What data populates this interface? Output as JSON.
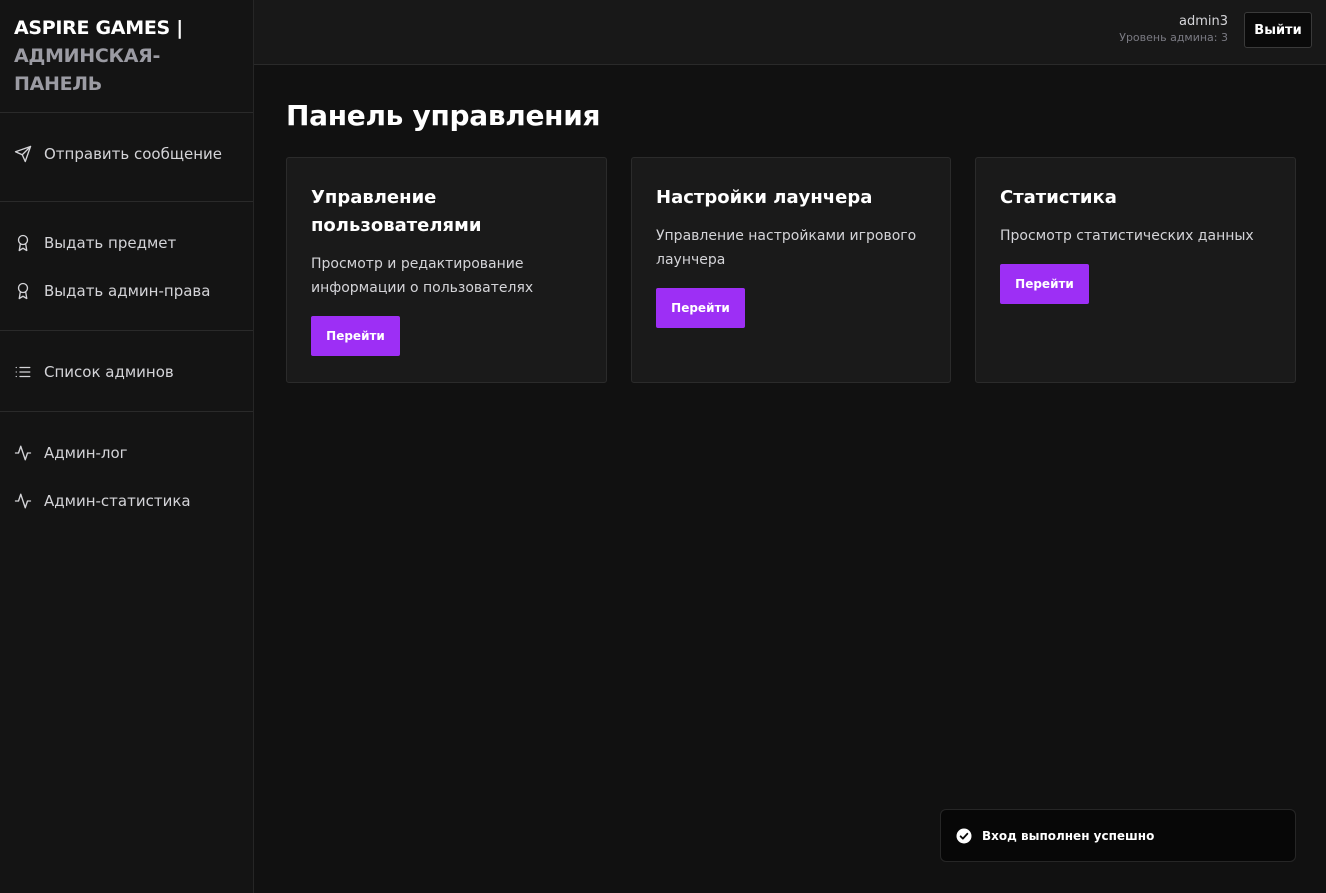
{
  "brand": {
    "line1": "ASPIRE GAMES |",
    "line2": "АДМИНСКАЯ-ПАНЕЛЬ"
  },
  "sidebar": {
    "groups": [
      {
        "items": [
          {
            "label": "Отправить сообщение",
            "icon": "send-icon"
          }
        ]
      },
      {
        "items": [
          {
            "label": "Выдать предмет",
            "icon": "award-icon"
          },
          {
            "label": "Выдать админ-права",
            "icon": "award-icon"
          }
        ]
      },
      {
        "items": [
          {
            "label": "Список админов",
            "icon": "list-icon"
          }
        ]
      },
      {
        "items": [
          {
            "label": "Админ-лог",
            "icon": "activity-icon"
          },
          {
            "label": "Админ-статистика",
            "icon": "activity-icon"
          }
        ]
      }
    ]
  },
  "header": {
    "username": "admin3",
    "level": "Уровень админа: 3",
    "logout_label": "Выйти"
  },
  "main": {
    "title": "Панель управления",
    "cards": [
      {
        "title": "Управление пользователями",
        "description": "Просмотр и редактирование информации о пользователях",
        "button": "Перейти"
      },
      {
        "title": "Настройки лаунчера",
        "description": "Управление настройками игрового лаунчера",
        "button": "Перейти"
      },
      {
        "title": "Статистика",
        "description": "Просмотр статистических данных",
        "button": "Перейти"
      }
    ]
  },
  "toast": {
    "message": "Вход выполнен успешно",
    "icon": "check-circle-icon"
  },
  "colors": {
    "accent": "#9d2ff5",
    "background": "#111111",
    "sidebar": "#141414",
    "card": "#1a1a1a"
  }
}
